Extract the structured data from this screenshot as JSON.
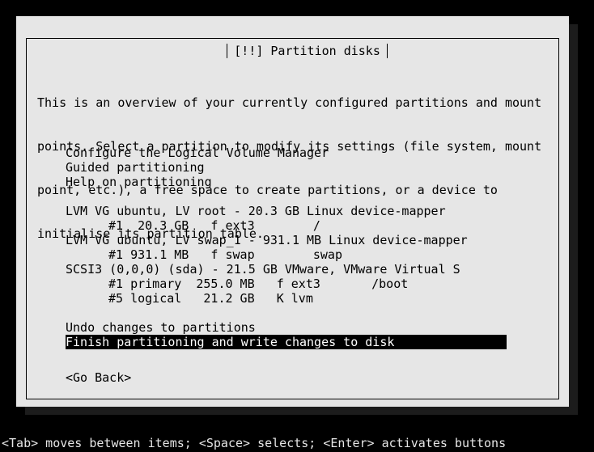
{
  "dialog": {
    "title": "[!!] Partition disks",
    "intro_lines": [
      "This is an overview of your currently configured partitions and mount",
      "points. Select a partition to modify its settings (file system, mount",
      "point, etc.), a free space to create partitions, or a device to",
      "initialise its partition table."
    ]
  },
  "menu": {
    "actions": [
      "Configure the Logical Volume Manager",
      "Guided partitioning",
      "Help on partitioning"
    ],
    "devices": [
      {
        "label": "LVM VG ubuntu, LV root - 20.3 GB Linux device-mapper",
        "partitions": [
          "#1  20.3 GB   f ext3        /"
        ]
      },
      {
        "label": "LVM VG ubuntu, LV swap_1 - 931.1 MB Linux device-mapper",
        "partitions": [
          "#1 931.1 MB   f swap        swap"
        ]
      },
      {
        "label": "SCSI3 (0,0,0) (sda) - 21.5 GB VMware, VMware Virtual S",
        "partitions": [
          "#1 primary  255.0 MB   f ext3       /boot",
          "#5 logical   21.2 GB   K lvm"
        ]
      }
    ],
    "undo": "Undo changes to partitions",
    "finish": "Finish partitioning and write changes to disk"
  },
  "buttons": {
    "go_back": "<Go Back>"
  },
  "help_bar": "<Tab> moves between items; <Space> selects; <Enter> activates buttons"
}
